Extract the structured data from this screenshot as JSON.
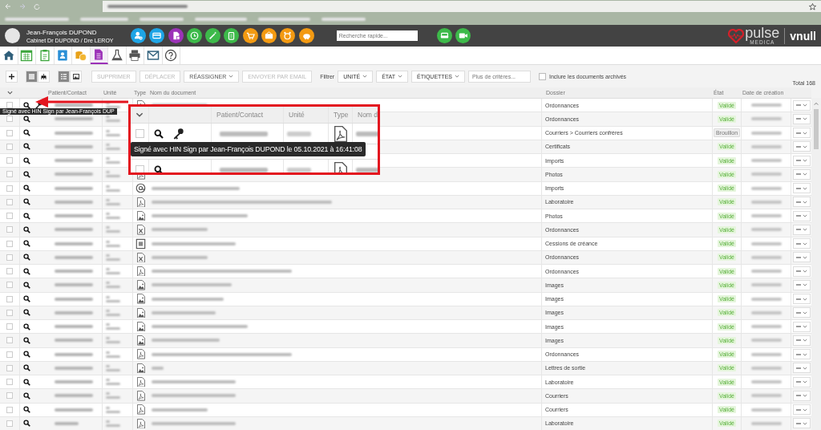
{
  "header": {
    "user_name": "Jean-François DUPOND",
    "practice": "Cabinet Dr DUPOND / Dre LEROY",
    "quick_actions": [
      {
        "kind": "user-gear",
        "color": "#1ea5e6"
      },
      {
        "kind": "card",
        "color": "#1ea5e6"
      },
      {
        "kind": "document",
        "color": "#9c32b8"
      },
      {
        "kind": "clock",
        "color": "#3dba4a"
      },
      {
        "kind": "wand",
        "color": "#3dba4a"
      },
      {
        "kind": "clipboard",
        "color": "#3dba4a"
      },
      {
        "kind": "cart",
        "color": "#f39a12"
      },
      {
        "kind": "cash",
        "color": "#f39a12"
      },
      {
        "kind": "alarm",
        "color": "#f39a12"
      },
      {
        "kind": "piggy",
        "color": "#f39a12"
      }
    ],
    "search": {
      "placeholder": "Recherche rapide..."
    },
    "call_actions": [
      {
        "kind": "armchair",
        "color": "#3dba4a"
      },
      {
        "kind": "video",
        "color": "#3dba4a"
      }
    ],
    "logo": {
      "brand": "pulse",
      "tagline": "MEDICA",
      "account": "vnull"
    }
  },
  "nav": [
    {
      "kind": "home",
      "selected": false
    },
    {
      "kind": "calendar",
      "selected": false
    },
    {
      "kind": "clipboard",
      "selected": false
    },
    {
      "kind": "contacts",
      "selected": false
    },
    {
      "kind": "coins",
      "selected": false
    },
    {
      "kind": "document",
      "selected": true
    },
    {
      "kind": "flask",
      "selected": false
    },
    {
      "kind": "printer",
      "selected": false
    },
    {
      "kind": "mail",
      "selected": false
    },
    {
      "kind": "help",
      "selected": false
    }
  ],
  "toolbar": {
    "view_modes": [
      {
        "kind": "list",
        "selected": true
      },
      {
        "kind": "tree",
        "selected": false
      }
    ],
    "display_modes": [
      {
        "kind": "details",
        "selected": true
      },
      {
        "kind": "thumbnails",
        "selected": false
      }
    ],
    "actions": [
      {
        "label": "SUPPRIMER",
        "disabled": true,
        "dropdown": false
      },
      {
        "label": "DÉPLACER",
        "disabled": true,
        "dropdown": false
      },
      {
        "label": "RÉASSIGNER",
        "disabled": false,
        "dropdown": true
      },
      {
        "label": "ENVOYER PAR EMAIL",
        "disabled": true,
        "dropdown": false
      }
    ],
    "filter_label": "Filtrer",
    "filters": [
      {
        "label": "UNITÉ"
      },
      {
        "label": "ÉTAT"
      },
      {
        "label": "ÉTIQUETTES"
      }
    ],
    "criteria": {
      "placeholder": "Plus de critères..."
    },
    "archived": {
      "label": "Inclure les documents archivés",
      "checked": false
    },
    "total": "Total 168"
  },
  "table": {
    "columns": [
      "Patient/Contact",
      "Unité",
      "Type",
      "Nom du document",
      "Dossier",
      "État",
      "Date de création"
    ],
    "rows": [
      {
        "checked": false,
        "signed": true,
        "kind": "pdf",
        "dossier": "Ordonnances",
        "state": "Validé",
        "validated": true
      },
      {
        "checked": false,
        "signed": false,
        "dossier": "Ordonnances",
        "state": "Validé",
        "validated": true
      },
      {
        "checked": false,
        "signed": false,
        "dossier": "Courriers > Courriers confrères",
        "state": "Brouillon",
        "validated": false
      },
      {
        "checked": false,
        "signed": false,
        "dossier": "Certificats",
        "state": "Validé",
        "validated": true
      },
      {
        "checked": false,
        "signed": false,
        "dossier": "Imports",
        "state": "Validé",
        "validated": true
      },
      {
        "checked": false,
        "signed": false,
        "kind": "pdf",
        "dossier": "Photos",
        "state": "Validé",
        "validated": true
      },
      {
        "checked": false,
        "signed": false,
        "kind": "email",
        "dossier": "Imports",
        "state": "Validé",
        "validated": true
      },
      {
        "checked": false,
        "signed": false,
        "kind": "pdf",
        "dossier": "Laboratoire",
        "state": "Validé",
        "validated": true
      },
      {
        "checked": false,
        "signed": false,
        "kind": "image",
        "dossier": "Photos",
        "state": "Validé",
        "validated": true
      },
      {
        "checked": false,
        "signed": false,
        "kind": "excel",
        "dossier": "Ordonnances",
        "state": "Validé",
        "validated": true
      },
      {
        "checked": false,
        "signed": false,
        "kind": "text",
        "dossier": "Cessions de créance",
        "state": "Validé",
        "validated": true
      },
      {
        "checked": false,
        "signed": false,
        "kind": "excel",
        "dossier": "Ordonnances",
        "state": "Validé",
        "validated": true
      },
      {
        "checked": false,
        "signed": false,
        "kind": "pdf",
        "dossier": "Ordonnances",
        "state": "Validé",
        "validated": true
      },
      {
        "checked": false,
        "signed": false,
        "kind": "image",
        "dossier": "Images",
        "state": "Validé",
        "validated": true
      },
      {
        "checked": false,
        "signed": false,
        "kind": "image",
        "dossier": "Images",
        "state": "Validé",
        "validated": true
      },
      {
        "checked": false,
        "signed": false,
        "kind": "image",
        "dossier": "Images",
        "state": "Validé",
        "validated": true
      },
      {
        "checked": false,
        "signed": false,
        "kind": "image",
        "dossier": "Images",
        "state": "Validé",
        "validated": true
      },
      {
        "checked": false,
        "signed": false,
        "kind": "image",
        "dossier": "Images",
        "state": "Validé",
        "validated": true
      },
      {
        "checked": false,
        "signed": false,
        "kind": "pdf",
        "dossier": "Ordonnances",
        "state": "Validé",
        "validated": true
      },
      {
        "checked": false,
        "signed": false,
        "kind": "image",
        "dossier": "Lettres de sortie",
        "state": "Validé",
        "validated": true
      },
      {
        "checked": false,
        "signed": false,
        "kind": "pdf",
        "dossier": "Laboratoire",
        "state": "Validé",
        "validated": true
      },
      {
        "checked": false,
        "signed": false,
        "kind": "pdf",
        "dossier": "Courriers",
        "state": "Validé",
        "validated": true
      },
      {
        "checked": false,
        "signed": false,
        "kind": "pdf",
        "dossier": "Courriers",
        "state": "Validé",
        "validated": true
      },
      {
        "checked": false,
        "signed": false,
        "kind": "pdf",
        "dossier": "Laboratoire",
        "state": "Validé",
        "validated": true
      }
    ],
    "row_tooltip": "Signé avec HIN Sign par Jean-François DUP"
  },
  "callout": {
    "columns": [
      "Patient/Contact",
      "Unité",
      "Type",
      "Nom d"
    ],
    "rows": [
      {
        "checked": false,
        "signed": true,
        "kind": "pdf"
      },
      {
        "checked": false,
        "signed": false,
        "kind": "pdf"
      }
    ],
    "tooltip": "Signé avec HIN Sign par Jean-François DUPOND le 05.10.2021 à 16:41:08"
  }
}
